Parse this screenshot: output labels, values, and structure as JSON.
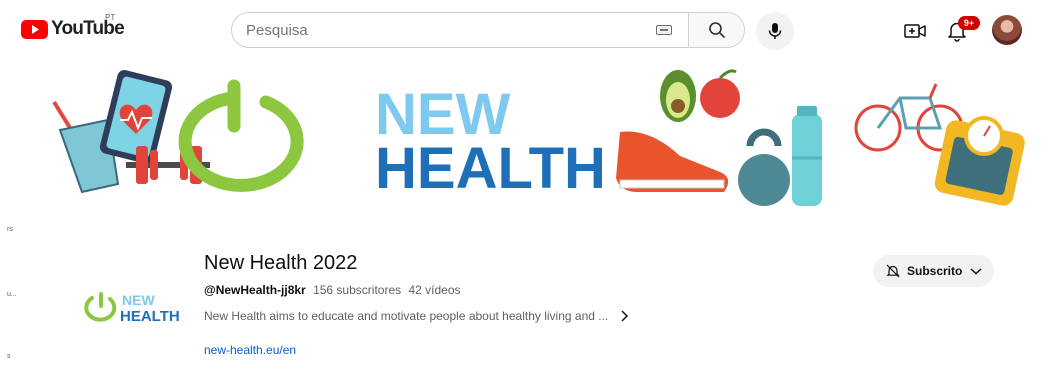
{
  "header": {
    "logo_text": "YouTube",
    "region": "PT",
    "search_placeholder": "Pesquisa",
    "notification_count": "9+"
  },
  "sidebar_fragments": [
    "rs",
    "u...",
    "s"
  ],
  "banner": {
    "word1": "NEW",
    "word2": "HEALTH"
  },
  "channel": {
    "logo_word1": "NEW",
    "logo_word2": "HEALTH",
    "name": "New Health 2022",
    "handle": "@NewHealth-jj8kr",
    "subscribers": "156 subscritores",
    "videos": "42 vídeos",
    "description": "New Health aims to educate and motivate people about healthy living and ...",
    "link": "new-health.eu/en",
    "subscribe_label": "Subscrito"
  },
  "colors": {
    "youtube_red": "#ff0000",
    "brand_green": "#8dc63f",
    "brand_light_blue": "#7fc8f0",
    "brand_dark_blue": "#1f6fb8",
    "link_blue": "#065fd4"
  }
}
